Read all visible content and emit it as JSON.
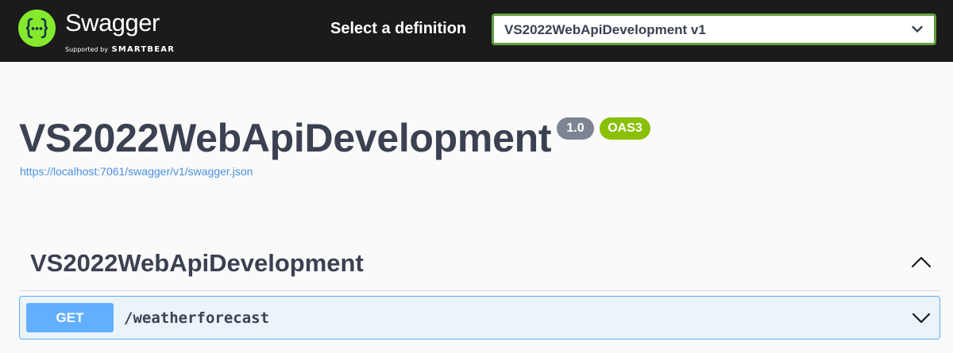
{
  "topbar": {
    "logo_title": "Swagger",
    "logo_supported_by": "Supported by",
    "logo_brand": "SMARTBEAR",
    "logo_icon": "swagger-braces-icon",
    "definition_label": "Select a definition",
    "definition_selected": "VS2022WebApiDevelopment v1",
    "colors": {
      "bar": "#1b1b1b",
      "logo_green": "#85ea2d",
      "select_border": "#62a03f"
    }
  },
  "info": {
    "title": "VS2022WebApiDevelopment",
    "version_badge": "1.0",
    "oas_badge": "OAS3",
    "spec_url": "https://localhost:7061/swagger/v1/swagger.json"
  },
  "tag": {
    "name": "VS2022WebApiDevelopment",
    "toggle_icon": "chevron-up-icon",
    "expanded": true
  },
  "operations": [
    {
      "method": "GET",
      "path": "/weatherforecast",
      "toggle_icon": "chevron-down-icon",
      "color": "#61affe"
    }
  ]
}
